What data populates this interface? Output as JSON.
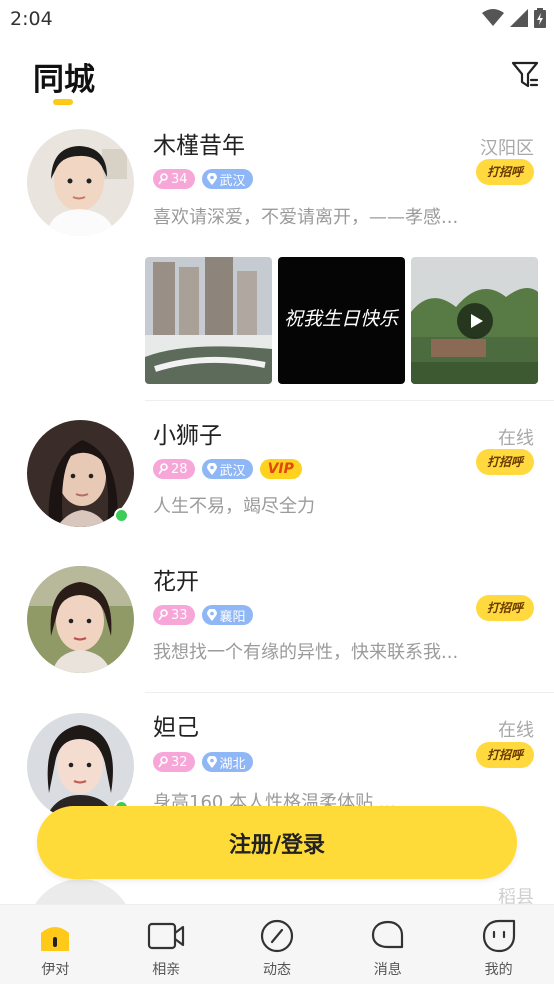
{
  "status_bar": {
    "time": "2:04"
  },
  "header": {
    "title": "同城"
  },
  "users": [
    {
      "name": "木槿昔年",
      "location": "汉阳区",
      "age": "34",
      "city": "武汉",
      "vip": false,
      "bio": "喜欢请深爱，不爱请离开，——孝感...",
      "online": false,
      "greet_label": "打招呼"
    },
    {
      "name": "小狮子",
      "location": "在线",
      "age": "28",
      "city": "武汉",
      "vip": true,
      "vip_label": "VIP",
      "bio": "人生不易，竭尽全力",
      "online": true,
      "greet_label": "打招呼"
    },
    {
      "name": "花开",
      "location": "",
      "age": "33",
      "city": "襄阳",
      "vip": false,
      "bio": "我想找一个有缘的异性，快来联系我...",
      "online": false,
      "greet_label": "打招呼"
    },
    {
      "name": "妲己",
      "location": "在线",
      "age": "32",
      "city": "湖北",
      "vip": false,
      "bio": "身高160  本人性格温柔体贴 ...",
      "online": true,
      "greet_label": "打招呼"
    },
    {
      "name": "",
      "location": "稻县",
      "age": "",
      "city": "",
      "vip": false,
      "bio": "",
      "online": false,
      "greet_label": ""
    }
  ],
  "photo_text": "祝我生日快乐",
  "cta": {
    "label": "注册/登录"
  },
  "nav": [
    {
      "label": "伊对",
      "icon": "home-icon",
      "active": true
    },
    {
      "label": "相亲",
      "icon": "video-icon",
      "active": false
    },
    {
      "label": "动态",
      "icon": "compass-icon",
      "active": false
    },
    {
      "label": "消息",
      "icon": "message-icon",
      "active": false
    },
    {
      "label": "我的",
      "icon": "profile-icon",
      "active": false
    }
  ],
  "colors": {
    "accent": "#ffd93d",
    "cta": "#ffdb3a",
    "online": "#3ccd56",
    "tag_age": "#f7a6d8",
    "tag_location": "#8fb6f5"
  }
}
